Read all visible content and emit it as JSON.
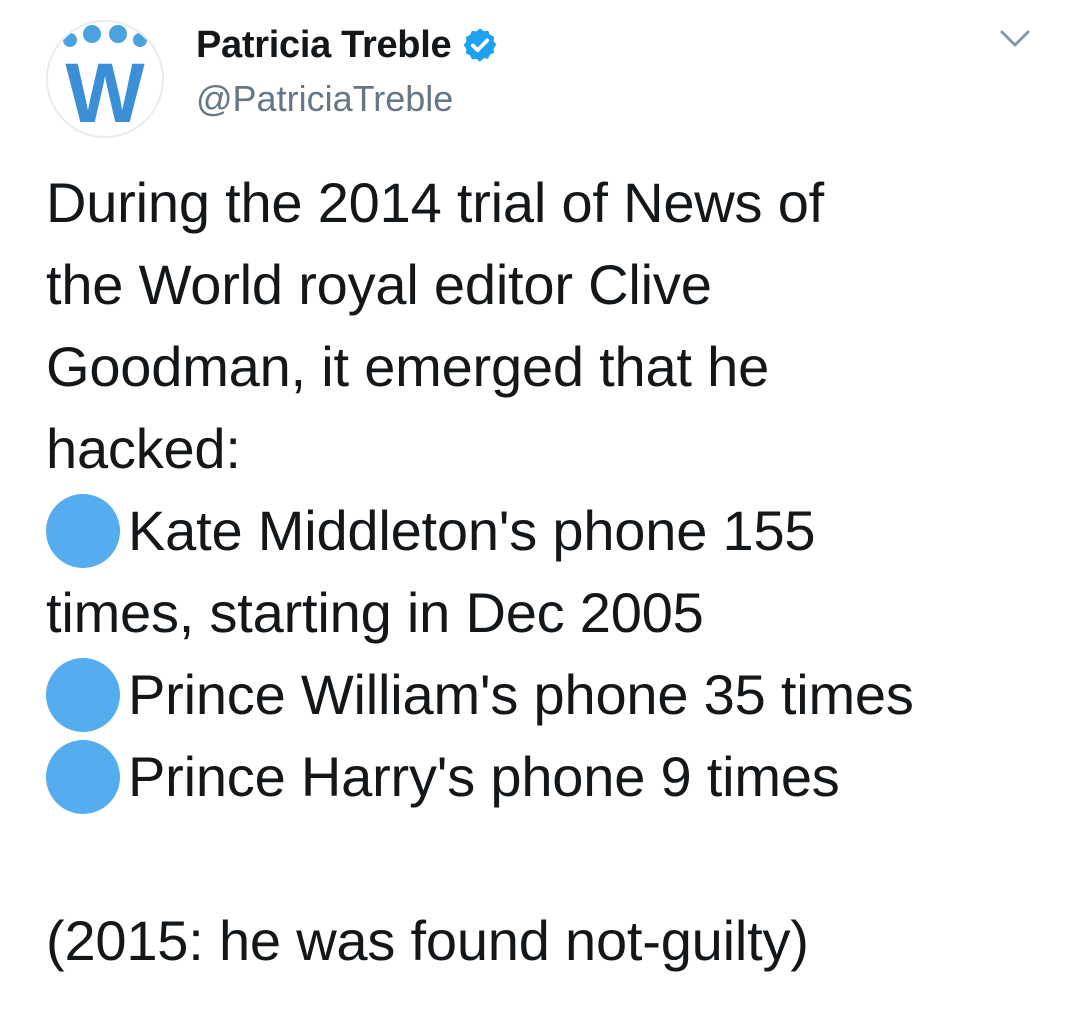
{
  "header": {
    "display_name": "Patricia Treble",
    "handle": "@PatriciaTreble",
    "verified": true,
    "avatar_logo_text": "W"
  },
  "tweet": {
    "intro_lines": [
      "During the 2014 trial of News of",
      "the World royal editor Clive",
      "Goodman,  it emerged that he",
      "hacked:"
    ],
    "bullets": [
      "Kate Middleton's phone 155",
      "Prince William's phone 35 times",
      "Prince Harry's phone 9 times"
    ],
    "bullet_continuation": "times, starting in Dec 2005",
    "footer": "(2015: he was found not-guilty)"
  },
  "colors": {
    "accent": "#1da1f2",
    "bullet": "#55acee",
    "text": "#14171a",
    "secondary_text": "#657786"
  },
  "icons": {
    "verified": "verified-badge-icon",
    "menu": "chevron-down-icon",
    "bullet": "blue-circle-emoji"
  }
}
